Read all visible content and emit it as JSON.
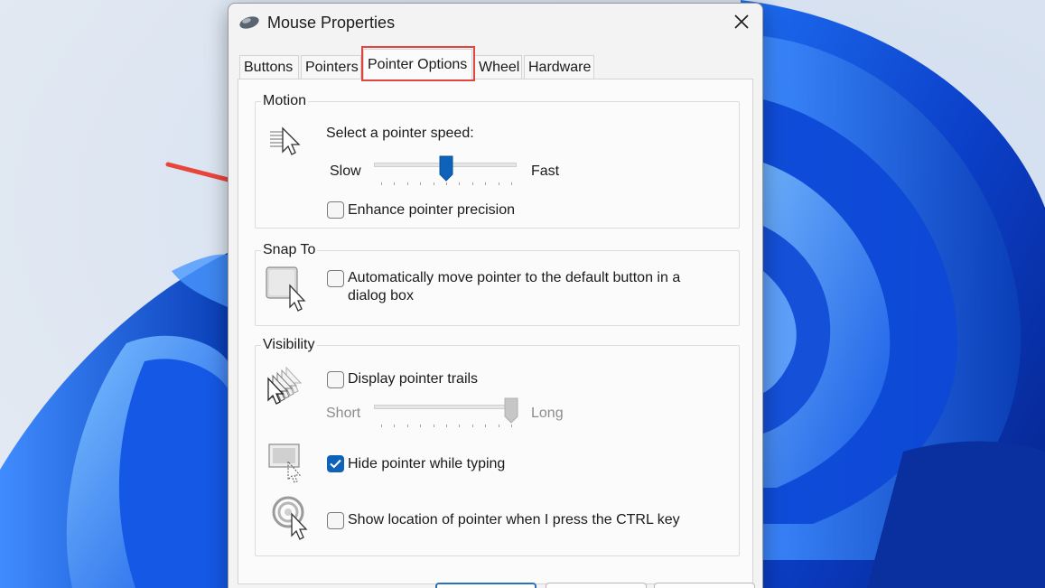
{
  "window": {
    "title": "Mouse Properties",
    "app_icon": "mouse-icon",
    "close_icon": "close-icon"
  },
  "tabs": [
    {
      "label": "Buttons",
      "active": false
    },
    {
      "label": "Pointers",
      "active": false
    },
    {
      "label": "Pointer Options",
      "active": true
    },
    {
      "label": "Wheel",
      "active": false
    },
    {
      "label": "Hardware",
      "active": false
    }
  ],
  "motion": {
    "title": "Motion",
    "speed_label": "Select a pointer speed:",
    "slow_label": "Slow",
    "fast_label": "Fast",
    "speed_value": 0.5,
    "enhance_precision": {
      "label": "Enhance pointer precision",
      "checked": false
    }
  },
  "snap_to": {
    "title": "Snap To",
    "auto_move": {
      "label": "Automatically move pointer to the default button in a dialog box",
      "checked": false
    }
  },
  "visibility": {
    "title": "Visibility",
    "trails": {
      "label": "Display pointer trails",
      "checked": false
    },
    "short_label": "Short",
    "long_label": "Long",
    "trail_length_value": 1.0,
    "hide_typing": {
      "label": "Hide pointer while typing",
      "checked": true
    },
    "show_location": {
      "label": "Show location of pointer when I press the CTRL key",
      "checked": false
    }
  },
  "colors": {
    "accent": "#0f62b9",
    "tab_highlight": "#e0453f",
    "annotation_arrow": "#e8453c"
  }
}
